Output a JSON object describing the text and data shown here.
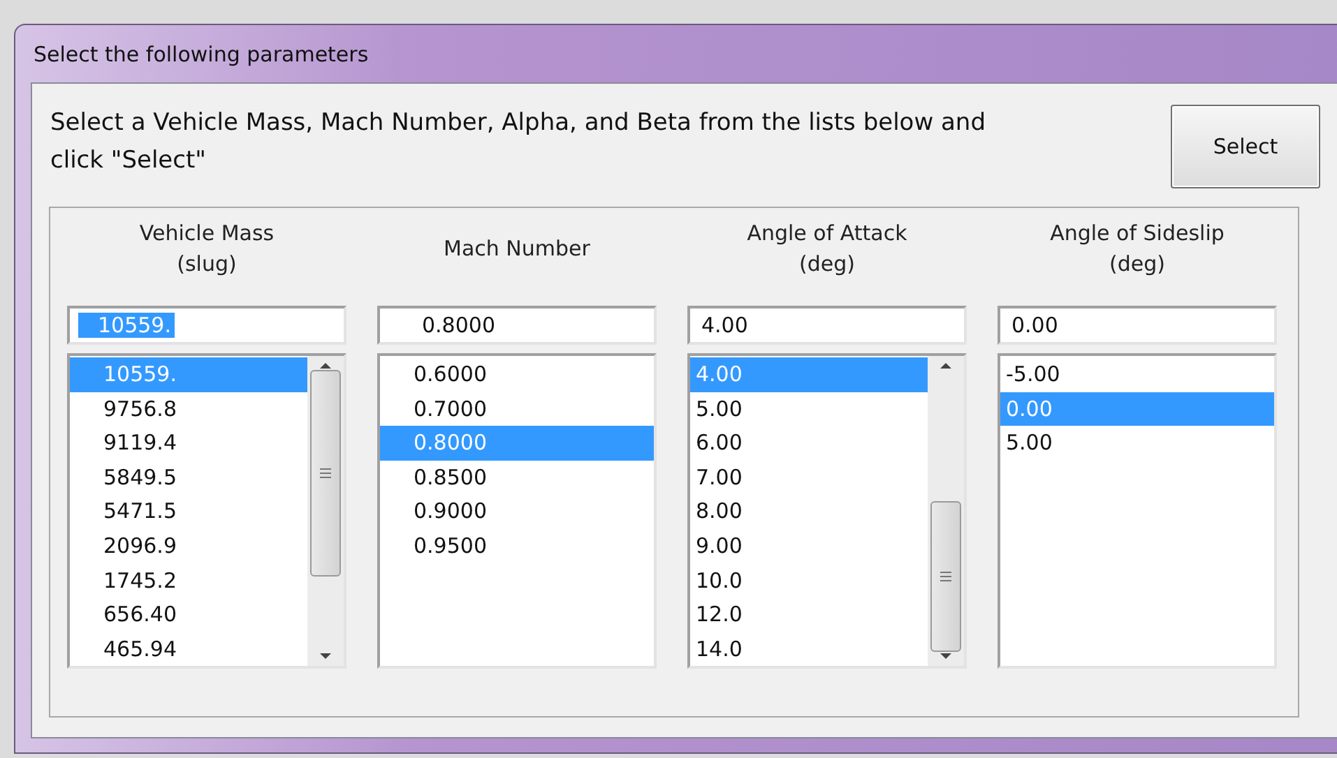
{
  "window": {
    "title": "Select the following parameters"
  },
  "instructions": "Select a Vehicle Mass, Mach Number, Alpha, and Beta from the lists below and click \"Select\"",
  "select_button": "Select",
  "columns": [
    {
      "header": "Vehicle Mass\n(slug)",
      "field": {
        "value": "10559.",
        "text_selected": true
      },
      "scrollable": true,
      "scrolled_down": false,
      "items": [
        {
          "label": "10559.",
          "selected": true
        },
        {
          "label": "9756.8",
          "selected": false
        },
        {
          "label": "9119.4",
          "selected": false
        },
        {
          "label": "5849.5",
          "selected": false
        },
        {
          "label": "5471.5",
          "selected": false
        },
        {
          "label": "2096.9",
          "selected": false
        },
        {
          "label": "1745.2",
          "selected": false
        },
        {
          "label": "656.40",
          "selected": false
        },
        {
          "label": "465.94",
          "selected": false
        }
      ]
    },
    {
      "header": "Mach Number",
      "field": {
        "value": "0.8000",
        "text_selected": false
      },
      "scrollable": false,
      "items": [
        {
          "label": "0.6000",
          "selected": false
        },
        {
          "label": "0.7000",
          "selected": false
        },
        {
          "label": "0.8000",
          "selected": true
        },
        {
          "label": "0.8500",
          "selected": false
        },
        {
          "label": "0.9000",
          "selected": false
        },
        {
          "label": "0.9500",
          "selected": false
        }
      ]
    },
    {
      "header": "Angle of Attack\n(deg)",
      "field": {
        "value": "4.00",
        "text_selected": false
      },
      "scrollable": true,
      "scrolled_down": true,
      "items": [
        {
          "label": "4.00",
          "selected": true
        },
        {
          "label": "5.00",
          "selected": false
        },
        {
          "label": "6.00",
          "selected": false
        },
        {
          "label": "7.00",
          "selected": false
        },
        {
          "label": "8.00",
          "selected": false
        },
        {
          "label": "9.00",
          "selected": false
        },
        {
          "label": "10.0",
          "selected": false
        },
        {
          "label": "12.0",
          "selected": false
        },
        {
          "label": "14.0",
          "selected": false
        }
      ]
    },
    {
      "header": "Angle of Sideslip\n(deg)",
      "field": {
        "value": "0.00",
        "text_selected": false
      },
      "scrollable": false,
      "items": [
        {
          "label": "-5.00",
          "selected": false
        },
        {
          "label": "0.00",
          "selected": true
        },
        {
          "label": "5.00",
          "selected": false
        }
      ]
    }
  ]
}
